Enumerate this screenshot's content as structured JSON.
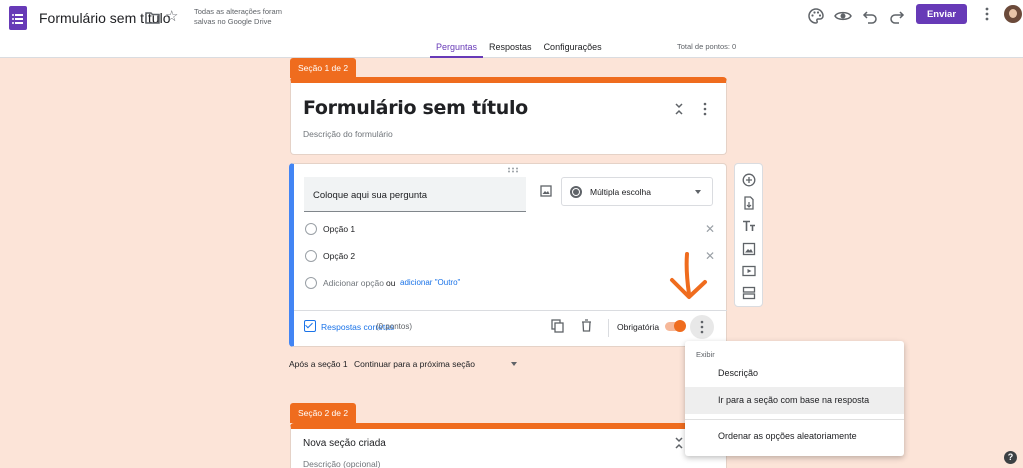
{
  "header": {
    "doc_title": "Formulário sem título",
    "saved_note": "Todas as alterações foram salvas no Google Drive",
    "send_label": "Enviar",
    "accent": "#673ab7",
    "icons": [
      "palette-icon",
      "eye-icon",
      "undo-icon",
      "redo-icon",
      "more-vert-icon"
    ]
  },
  "tabs": [
    {
      "label": "Perguntas",
      "active": true
    },
    {
      "label": "Respostas",
      "active": false
    },
    {
      "label": "Configurações",
      "active": false
    }
  ],
  "total_points": "Total de pontos: 0",
  "section1": {
    "tab_label": "Seção 1 de 2",
    "title": "Formulário sem título",
    "description": "Descrição do formulário"
  },
  "question": {
    "placeholder": "Coloque aqui sua pergunta",
    "type": "Múltipla escolha",
    "options": [
      "Opção 1",
      "Opção 2"
    ],
    "add_option": "Adicionar opção",
    "or": "ou",
    "add_other": "adicionar \"Outro\"",
    "answer_key": "Respostas corretas",
    "points": "(0 pontos)",
    "required_label": "Obrigatória",
    "required": true
  },
  "after_section": {
    "label": "Após a seção 1",
    "value": "Continuar para a próxima seção"
  },
  "section2": {
    "tab_label": "Seção 2 de 2",
    "title": "Nova seção criada",
    "description": "Descrição (opcional)"
  },
  "menu": {
    "header": "Exibir",
    "items": [
      "Descrição",
      "Ir para a seção com base na resposta",
      "Ordenar as opções aleatoriamente"
    ],
    "highlighted_index": 1
  },
  "colors": {
    "theme": "#ef6c1e",
    "background": "#fce4d8",
    "question_accent": "#4285f4",
    "link": "#1a73e8"
  }
}
